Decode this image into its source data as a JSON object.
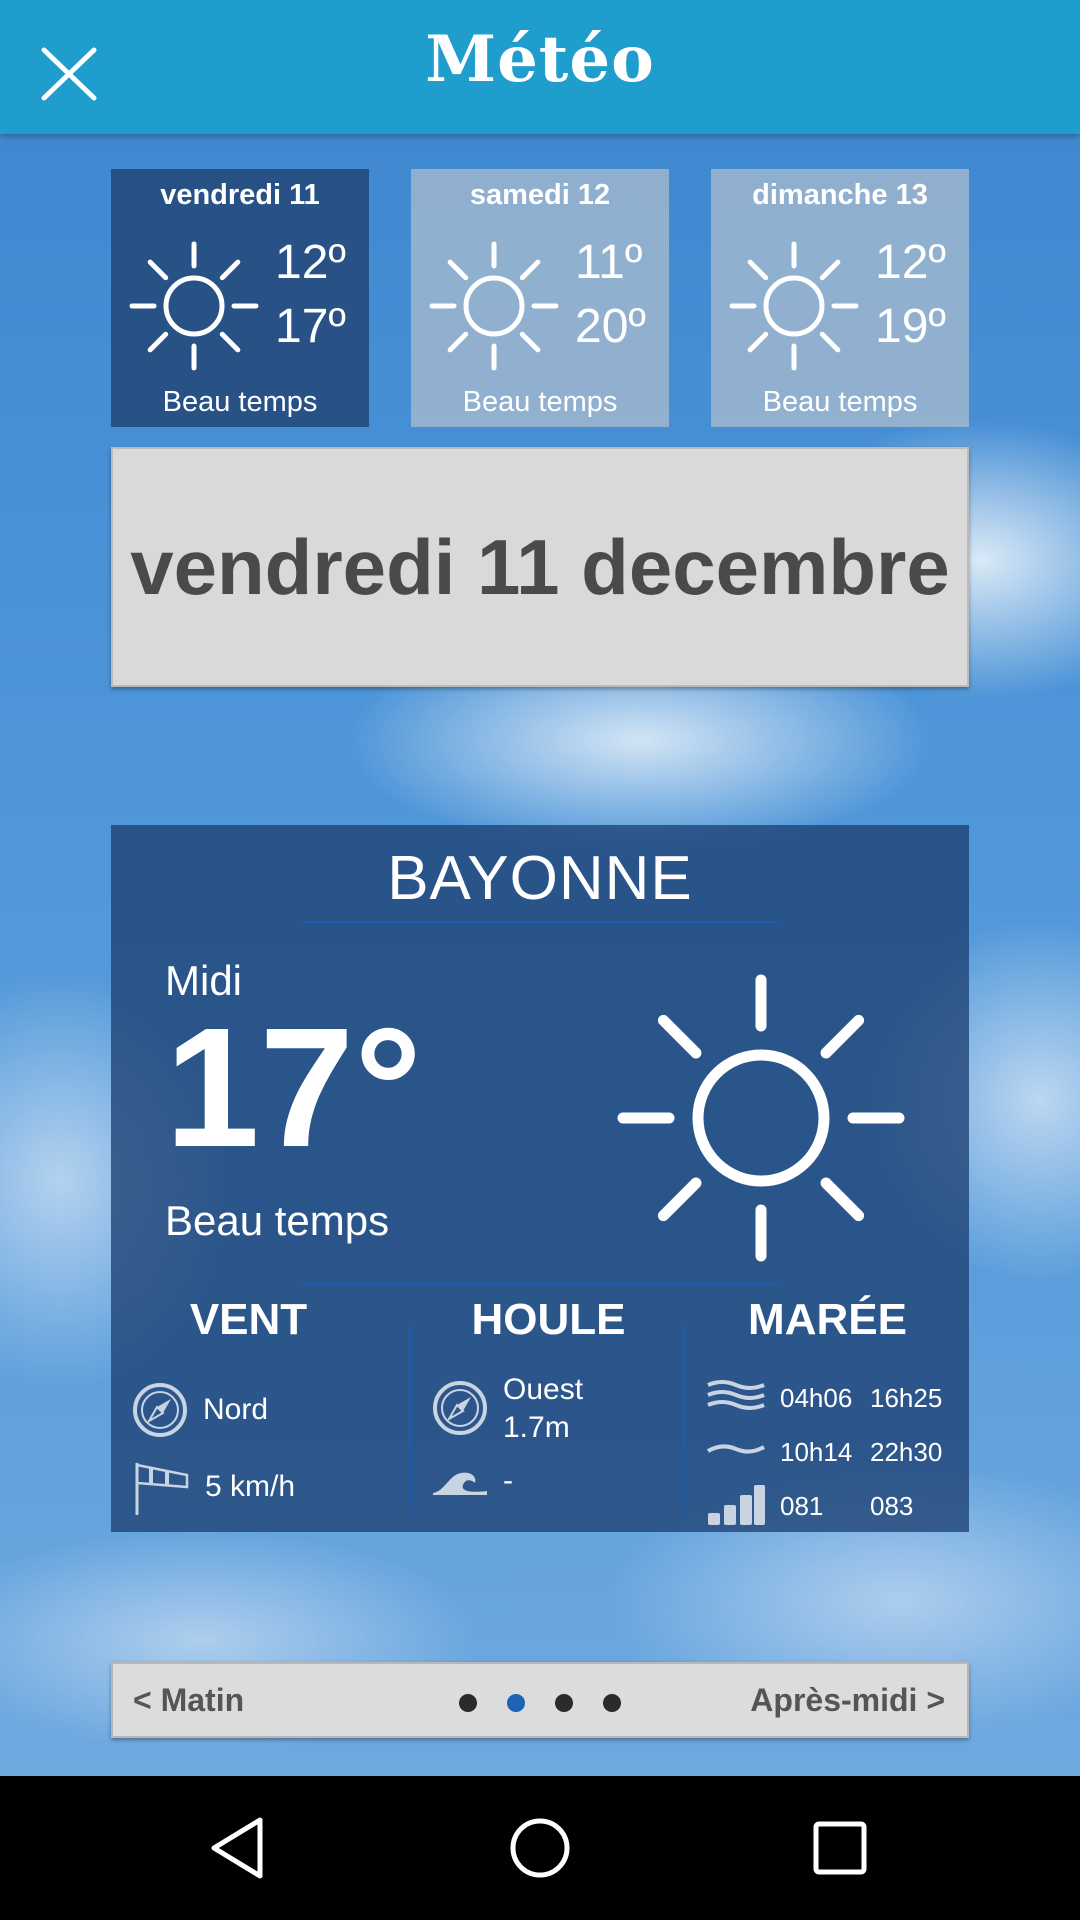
{
  "app": {
    "title": "Météo"
  },
  "days": [
    {
      "name": "vendredi 11",
      "min": "12º",
      "max": "17º",
      "condition": "Beau temps",
      "icon": "sun-icon",
      "active": true
    },
    {
      "name": "samedi 12",
      "min": "11º",
      "max": "20º",
      "condition": "Beau temps",
      "icon": "sun-icon",
      "active": false
    },
    {
      "name": "dimanche 13",
      "min": "12º",
      "max": "19º",
      "condition": "Beau temps",
      "icon": "sun-icon",
      "active": false
    }
  ],
  "date_banner": "vendredi 11 decembre",
  "current": {
    "city": "BAYONNE",
    "period": "Midi",
    "temperature": "17°",
    "condition": "Beau temps",
    "icon": "sun-icon"
  },
  "vent": {
    "title": "VENT",
    "direction": "Nord",
    "speed": "5 km/h",
    "icons": [
      "compass-icon",
      "windsock-icon"
    ]
  },
  "houle": {
    "title": "HOULE",
    "direction": "Ouest",
    "height": "1.7m",
    "extra": "-",
    "icons": [
      "compass-icon",
      "wave-icon"
    ]
  },
  "maree": {
    "title": "MARÉE",
    "high": [
      "04h06",
      "16h25"
    ],
    "low": [
      "10h14",
      "22h30"
    ],
    "coef": [
      "081",
      "083"
    ],
    "icons": [
      "high-tide-icon",
      "low-tide-icon",
      "coefficient-icon"
    ]
  },
  "pager": {
    "prev": "< Matin",
    "next": "Après-midi >",
    "pages": 4,
    "current_page": 2,
    "colors": {
      "dot": "#2b2b2b",
      "selected_dot": "#1e63b6"
    }
  },
  "colors": {
    "appbar": "#1f9dcc",
    "card": "#1e4173",
    "accent_line": "#1b5cb0"
  }
}
